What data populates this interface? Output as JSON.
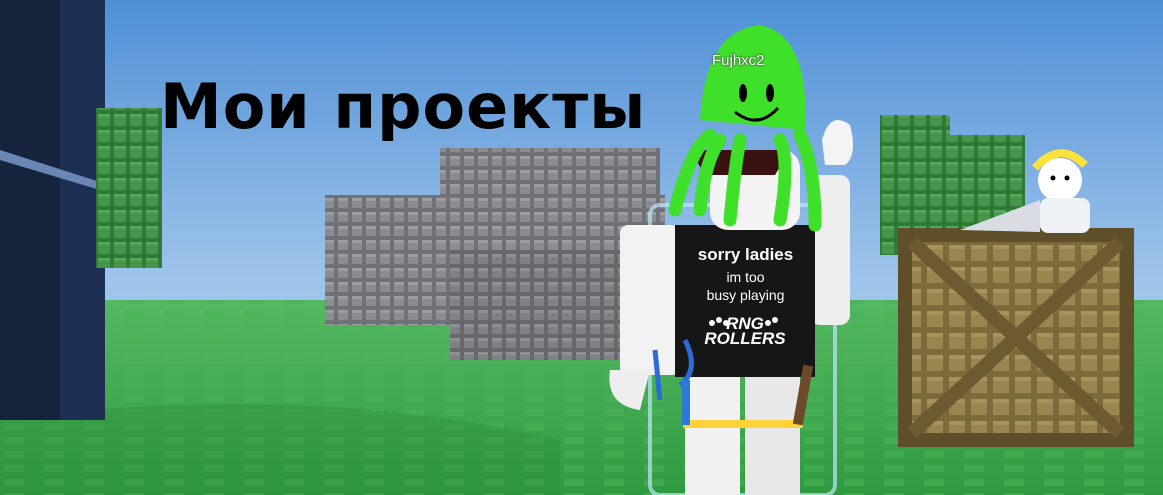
{
  "title": "Мои  проекты",
  "player": {
    "name": "Fujhxc2",
    "shirt": {
      "line1": "sorry ladies",
      "line2": "im too",
      "line3": "busy playing",
      "logo_top": "RNG",
      "logo_bottom": "ROLLERS"
    }
  },
  "colors": {
    "sky": "#7fb3e6",
    "ground": "#3fa84f",
    "bricks_gray": "#7a7c80",
    "trees": "#3f8f45",
    "crate": "#8a7442",
    "accessory": "#3ee02a"
  }
}
